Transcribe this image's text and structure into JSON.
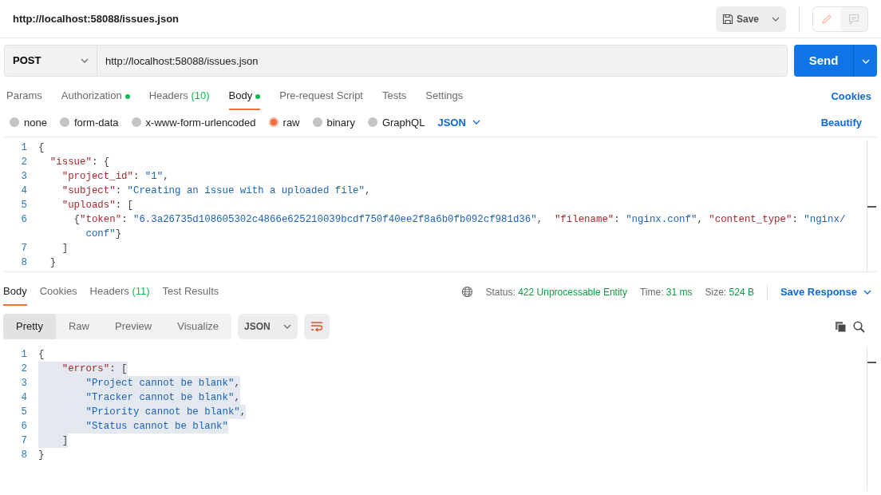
{
  "header": {
    "title": "http://localhost:58088/issues.json",
    "save_label": "Save"
  },
  "request": {
    "method": "POST",
    "url": "http://localhost:58088/issues.json",
    "send_label": "Send"
  },
  "request_tabs": [
    {
      "label": "Params",
      "indicator": false,
      "selected": false
    },
    {
      "label": "Authorization",
      "indicator": true,
      "selected": false
    },
    {
      "label": "Headers",
      "count": "(10)",
      "indicator": false,
      "selected": false
    },
    {
      "label": "Body",
      "indicator": true,
      "selected": true
    },
    {
      "label": "Pre-request Script",
      "indicator": false,
      "selected": false
    },
    {
      "label": "Tests",
      "indicator": false,
      "selected": false
    },
    {
      "label": "Settings",
      "indicator": false,
      "selected": false
    }
  ],
  "cookies_link": "Cookies",
  "body_types": [
    {
      "label": "none",
      "selected": false
    },
    {
      "label": "form-data",
      "selected": false
    },
    {
      "label": "x-www-form-urlencoded",
      "selected": false
    },
    {
      "label": "raw",
      "selected": true
    },
    {
      "label": "binary",
      "selected": false
    },
    {
      "label": "GraphQL",
      "selected": false
    }
  ],
  "body_format": "JSON",
  "beautify_link": "Beautify",
  "request_body": [
    {
      "number": "1",
      "segments": [
        {
          "kind": "punct",
          "text": "{"
        }
      ]
    },
    {
      "number": "2",
      "segments": [
        {
          "kind": "key",
          "text": "  \"issue\""
        },
        {
          "kind": "punct",
          "text": ": {"
        }
      ]
    },
    {
      "number": "3",
      "segments": [
        {
          "kind": "key",
          "text": "    \"project_id\""
        },
        {
          "kind": "punct",
          "text": ": "
        },
        {
          "kind": "string",
          "text": "\"1\""
        },
        {
          "kind": "punct",
          "text": ","
        }
      ]
    },
    {
      "number": "4",
      "segments": [
        {
          "kind": "key",
          "text": "    \"subject\""
        },
        {
          "kind": "punct",
          "text": ": "
        },
        {
          "kind": "string",
          "text": "\"Creating an issue with a uploaded file\""
        },
        {
          "kind": "punct",
          "text": ","
        }
      ]
    },
    {
      "number": "5",
      "segments": [
        {
          "kind": "key",
          "text": "    \"uploads\""
        },
        {
          "kind": "punct",
          "text": ": ["
        }
      ]
    },
    {
      "number": "6",
      "segments": [
        {
          "kind": "punct",
          "text": "      {"
        },
        {
          "kind": "key",
          "text": "\"token\""
        },
        {
          "kind": "punct",
          "text": ": "
        },
        {
          "kind": "string",
          "text": "\"6.3a26735d108605302c4866e625210039bcdf750f40ee2f8a6b0fb092cf981d36\""
        },
        {
          "kind": "punct",
          "text": ",  "
        },
        {
          "kind": "key",
          "text": "\"filename\""
        },
        {
          "kind": "punct",
          "text": ": "
        },
        {
          "kind": "string",
          "text": "\"nginx.conf\""
        },
        {
          "kind": "punct",
          "text": ", "
        },
        {
          "kind": "key",
          "text": "\"content_type\""
        },
        {
          "kind": "punct",
          "text": ": "
        },
        {
          "kind": "string",
          "text": "\"nginx/"
        }
      ]
    },
    {
      "segments": [
        {
          "kind": "string",
          "text": "        conf\""
        },
        {
          "kind": "punct",
          "text": "}"
        }
      ]
    },
    {
      "number": "7",
      "segments": [
        {
          "kind": "punct",
          "text": "    ]"
        }
      ]
    },
    {
      "number": "8",
      "segments": [
        {
          "kind": "punct",
          "text": "  }"
        }
      ]
    }
  ],
  "response_tabs": [
    {
      "label": "Body",
      "selected": true
    },
    {
      "label": "Cookies",
      "selected": false
    },
    {
      "label": "Headers",
      "count": "(11)",
      "selected": false
    },
    {
      "label": "Test Results",
      "selected": false
    }
  ],
  "response_meta": [
    {
      "label": "Status:",
      "value": "422 Unprocessable Entity"
    },
    {
      "label": "Time:",
      "value": "31 ms"
    },
    {
      "label": "Size:",
      "value": "524 B"
    }
  ],
  "save_response": "Save Response",
  "view_modes": [
    {
      "label": "Pretty",
      "selected": true
    },
    {
      "label": "Raw",
      "selected": false
    },
    {
      "label": "Preview",
      "selected": false
    },
    {
      "label": "Visualize",
      "selected": false
    }
  ],
  "response_format": "JSON",
  "response_body": [
    {
      "number": "1",
      "highlighted": false,
      "segments": [
        {
          "kind": "punct",
          "text": "{"
        }
      ]
    },
    {
      "number": "2",
      "highlighted": true,
      "segments": [
        {
          "kind": "key",
          "text": "    \"errors\""
        },
        {
          "kind": "punct",
          "text": ": ["
        }
      ]
    },
    {
      "number": "3",
      "highlighted": true,
      "segments": [
        {
          "kind": "string",
          "text": "        \"Project cannot be blank\""
        },
        {
          "kind": "punct",
          "text": ","
        }
      ]
    },
    {
      "number": "4",
      "highlighted": true,
      "segments": [
        {
          "kind": "string",
          "text": "        \"Tracker cannot be blank\""
        },
        {
          "kind": "punct",
          "text": ","
        }
      ]
    },
    {
      "number": "5",
      "highlighted": true,
      "segments": [
        {
          "kind": "string",
          "text": "        \"Priority cannot be blank\""
        },
        {
          "kind": "punct",
          "text": ","
        }
      ]
    },
    {
      "number": "6",
      "highlighted": true,
      "segments": [
        {
          "kind": "string",
          "text": "        \"Status cannot be blank\""
        }
      ]
    },
    {
      "number": "7",
      "highlighted": true,
      "segments": [
        {
          "kind": "punct",
          "text": "    ]"
        }
      ]
    },
    {
      "number": "8",
      "highlighted": false,
      "segments": [
        {
          "kind": "punct",
          "text": "}"
        }
      ]
    }
  ]
}
